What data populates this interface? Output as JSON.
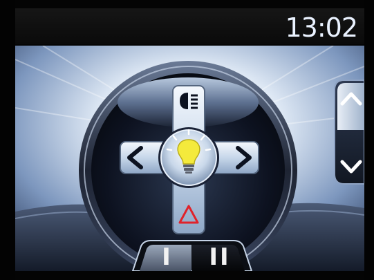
{
  "status_bar": {
    "clock": "13:02"
  },
  "control_pad": {
    "center_icon": "light-bulb-icon",
    "up_icon": "headlight-icon",
    "left_icon": "chevron-left-icon",
    "right_icon": "chevron-right-icon",
    "down_icon": "hazard-triangle-icon"
  },
  "side_scroller": {
    "up_icon": "chevron-up-icon",
    "down_icon": "chevron-down-icon"
  },
  "bottom_tabs": [
    {
      "label": "I"
    },
    {
      "label": "II"
    }
  ],
  "colors": {
    "bulb": "#f4ea3c",
    "hazard": "#e0222a",
    "accent_blue": "#9fc2ea"
  }
}
